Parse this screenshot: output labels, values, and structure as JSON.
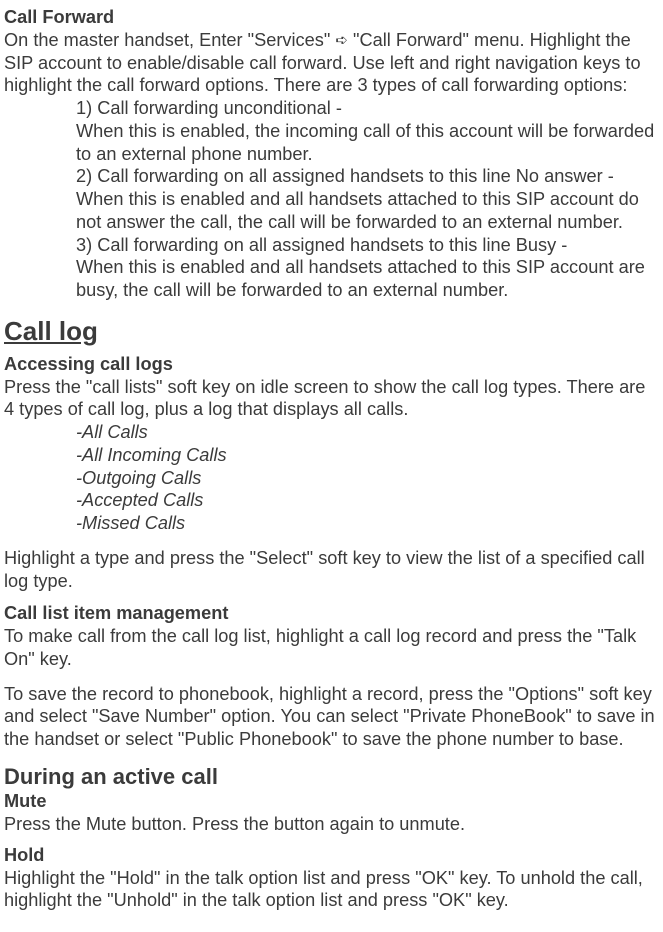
{
  "callForward": {
    "heading": "Call Forward",
    "intro1": "On the master handset, Enter \"Services\" ",
    "arrow": "➪",
    "intro2": " \"Call Forward\" menu. Highlight the SIP account to enable/disable call forward. Use left and right navigation keys to highlight the call forward options. There are 3 types of call forwarding options:",
    "opt1a": "1) Call forwarding unconditional -",
    "opt1b": "When this is enabled, the incoming call of this account will be forwarded to an external phone number.",
    "opt2a": "2) Call forwarding on all assigned handsets to this line No answer -",
    "opt2b": "When this is enabled and all handsets attached to this SIP account do not answer the call, the call will be forwarded to an external number.",
    "opt3a": "3) Call forwarding on all assigned handsets to this line Busy -",
    "opt3b": "When this is enabled and all handsets attached to this SIP account are busy, the call will be forwarded to an external number."
  },
  "callLog": {
    "title": "Call log",
    "accessHeading": "Accessing call logs",
    "accessBody": "Press the \"call lists\" soft key on idle screen to show the call log types. There are 4 types of call log, plus a log that displays all calls.",
    "list": {
      "l1": "-All Calls",
      "l2": "-All Incoming Calls",
      "l3": "-Outgoing Calls",
      "l4": "-Accepted Calls",
      "l5": "-Missed Calls"
    },
    "selectBody": "Highlight a type and press the \"Select\" soft key to view the list of a specified call log type.",
    "mgmtHeading": "Call list item management",
    "mgmtBody1": "To make call from the call log list, highlight a call log record and press the \"Talk On\" key.",
    "mgmtBody2": "To save the record to phonebook, highlight a record, press the \"Options\" soft key and select \"Save Number\" option. You can select \"Private PhoneBook\" to save in the handset or select \"Public Phonebook\" to save the phone number to base."
  },
  "activeCall": {
    "title": "During an active call",
    "muteHeading": "Mute",
    "muteBody": "Press the Mute button. Press the button again to unmute.",
    "holdHeading": "Hold",
    "holdBody": "Highlight the \"Hold\" in the talk option list and press \"OK\" key. To unhold the call, highlight the \"Unhold\" in the talk option list and press \"OK\" key."
  }
}
